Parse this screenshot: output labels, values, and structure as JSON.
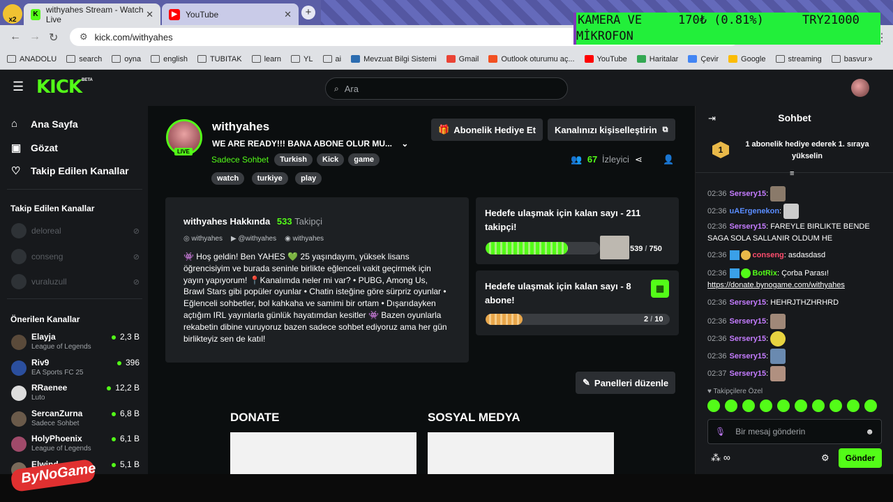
{
  "browser": {
    "tabs": [
      {
        "title": "withyahes Stream - Watch Live",
        "active": true
      },
      {
        "title": "YouTube",
        "active": false
      }
    ],
    "url": "kick.com/withyahes",
    "bookmarks": [
      "ANADOLU",
      "search",
      "oyna",
      "english",
      "TUBITAK",
      "learn",
      "YL",
      "ai",
      "Mevzuat Bilgi Sistemi",
      "Gmail",
      "Outlook oturumu aç...",
      "YouTube",
      "Haritalar",
      "Çevir",
      "Google",
      "streaming",
      "basvur"
    ],
    "overlay": {
      "line1": "KAMERA VE",
      "line2": "MİKROFON",
      "price": "170₺ (0.81%)",
      "total": "TRY21000"
    },
    "corner_badge": "x2"
  },
  "kick": {
    "logo": "KICK",
    "beta": "BETA",
    "search_placeholder": "Ara"
  },
  "sidebar": {
    "nav": [
      "Ana Sayfa",
      "Gözat",
      "Takip Edilen Kanallar"
    ],
    "followed_title": "Takip Edilen Kanallar",
    "followed": [
      "deloreal",
      "conseng",
      "vuraluzull"
    ],
    "recommended_title": "Önerilen Kanallar",
    "recommended": [
      {
        "name": "Elayja",
        "category": "League of Legends",
        "viewers": "2,3 B"
      },
      {
        "name": "Riv9",
        "category": "EA Sports FC 25",
        "viewers": "396"
      },
      {
        "name": "RRaenee",
        "category": "Luto",
        "viewers": "12,2 B"
      },
      {
        "name": "SercanZurna",
        "category": "Sadece Sohbet",
        "viewers": "6,8 B"
      },
      {
        "name": "HolyPhoenix",
        "category": "League of Legends",
        "viewers": "6,1 B"
      },
      {
        "name": "Elwind",
        "category": "",
        "viewers": "5,1 B"
      }
    ]
  },
  "channel": {
    "name": "withyahes",
    "live_badge": "LIVE",
    "stream_title": "WE ARE READY!!! BANA ABONE OLUR MU...",
    "category": "Sadece Sohbet",
    "tags": [
      "Turkish",
      "Kick",
      "game",
      "watch",
      "turkiye",
      "play"
    ],
    "gift_button": "Abonelik Hediye Et",
    "customize_button": "Kanalınızı kişiselleştirin",
    "viewers_count": "67",
    "viewers_label": "İzleyici"
  },
  "about": {
    "title": "withyahes Hakkında",
    "followers_count": "533",
    "followers_label": "Takipçi",
    "socials": [
      "withyahes",
      "@withyahes",
      "withyahes"
    ],
    "bio": "👾 Hoş geldin! Ben YAHES 💚 25 yaşındayım, yüksek lisans öğrencisiyim ve burada seninle birlikte eğlenceli vakit geçirmek için yayın yapıyorum! 📍Kanalımda neler mi var? • PUBG, Among Us, Brawl Stars gibi popüler oyunlar • Chatin isteğine göre sürpriz oyunlar • Eğlenceli sohbetler, bol kahkaha ve samimi bir ortam • Dışarıdayken açtığım IRL yayınlarla günlük hayatımdan kesitler 👾 Bazen oyunlarla rekabetin dibine vuruyoruz bazen sadece sohbet ediyoruz ama her gün birlikteyiz sen de katıl!"
  },
  "goals": [
    {
      "title": "Hedefe ulaşmak için kalan sayı - 211 takipçi!",
      "current": "539",
      "target": "750",
      "progress": 0.72
    },
    {
      "title": "Hedefe ulaşmak için kalan sayı - 8 abone!",
      "current": "2",
      "target": "10",
      "progress": 0.2
    }
  ],
  "panels": {
    "edit_button": "Panelleri düzenle",
    "titles": [
      "DONATE",
      "SOSYAL MEDYA"
    ]
  },
  "chat": {
    "title": "Sohbet",
    "rank_number": "1",
    "pinned": "1 abonelik hediye ederek 1. sıraya yükselin",
    "messages": [
      {
        "time": "02:36",
        "user": "Sersery15",
        "color": "#c47cff",
        "text": ""
      },
      {
        "time": "02:36",
        "user": "uAErgenekon",
        "color": "#5a8dff",
        "text": ""
      },
      {
        "time": "02:36",
        "user": "Sersery15",
        "color": "#c47cff",
        "text": "FAREYLE BIRLIKTE BENDE SAGA SOLA SALLANIR OLDUM HE"
      },
      {
        "time": "02:36",
        "user": "conseng",
        "color": "#ff4d6d",
        "text": "asdasdasd"
      },
      {
        "time": "02:36",
        "user": "BotRix",
        "color": "#53fc18",
        "text": "Çorba Parası!",
        "link": "https://donate.bynogame.com/withyahes"
      },
      {
        "time": "02:36",
        "user": "Sersery15",
        "color": "#c47cff",
        "text": "HEHRJTHZHRHRD"
      },
      {
        "time": "02:36",
        "user": "Sersery15",
        "color": "#c47cff",
        "text": ""
      },
      {
        "time": "02:36",
        "user": "Sersery15",
        "color": "#c47cff",
        "text": ""
      },
      {
        "time": "02:36",
        "user": "Sersery15",
        "color": "#c47cff",
        "text": ""
      },
      {
        "time": "02:37",
        "user": "Sersery15",
        "color": "#c47cff",
        "text": ""
      }
    ],
    "emote_label": "Takipçilere Özel",
    "input_placeholder": "Bir mesaj gönderin",
    "send_button": "Gönder"
  },
  "watermark": "ByNoGame",
  "colors": {
    "accent": "#53fc18",
    "bg": "#0b0e0f",
    "panel": "#17191c"
  }
}
